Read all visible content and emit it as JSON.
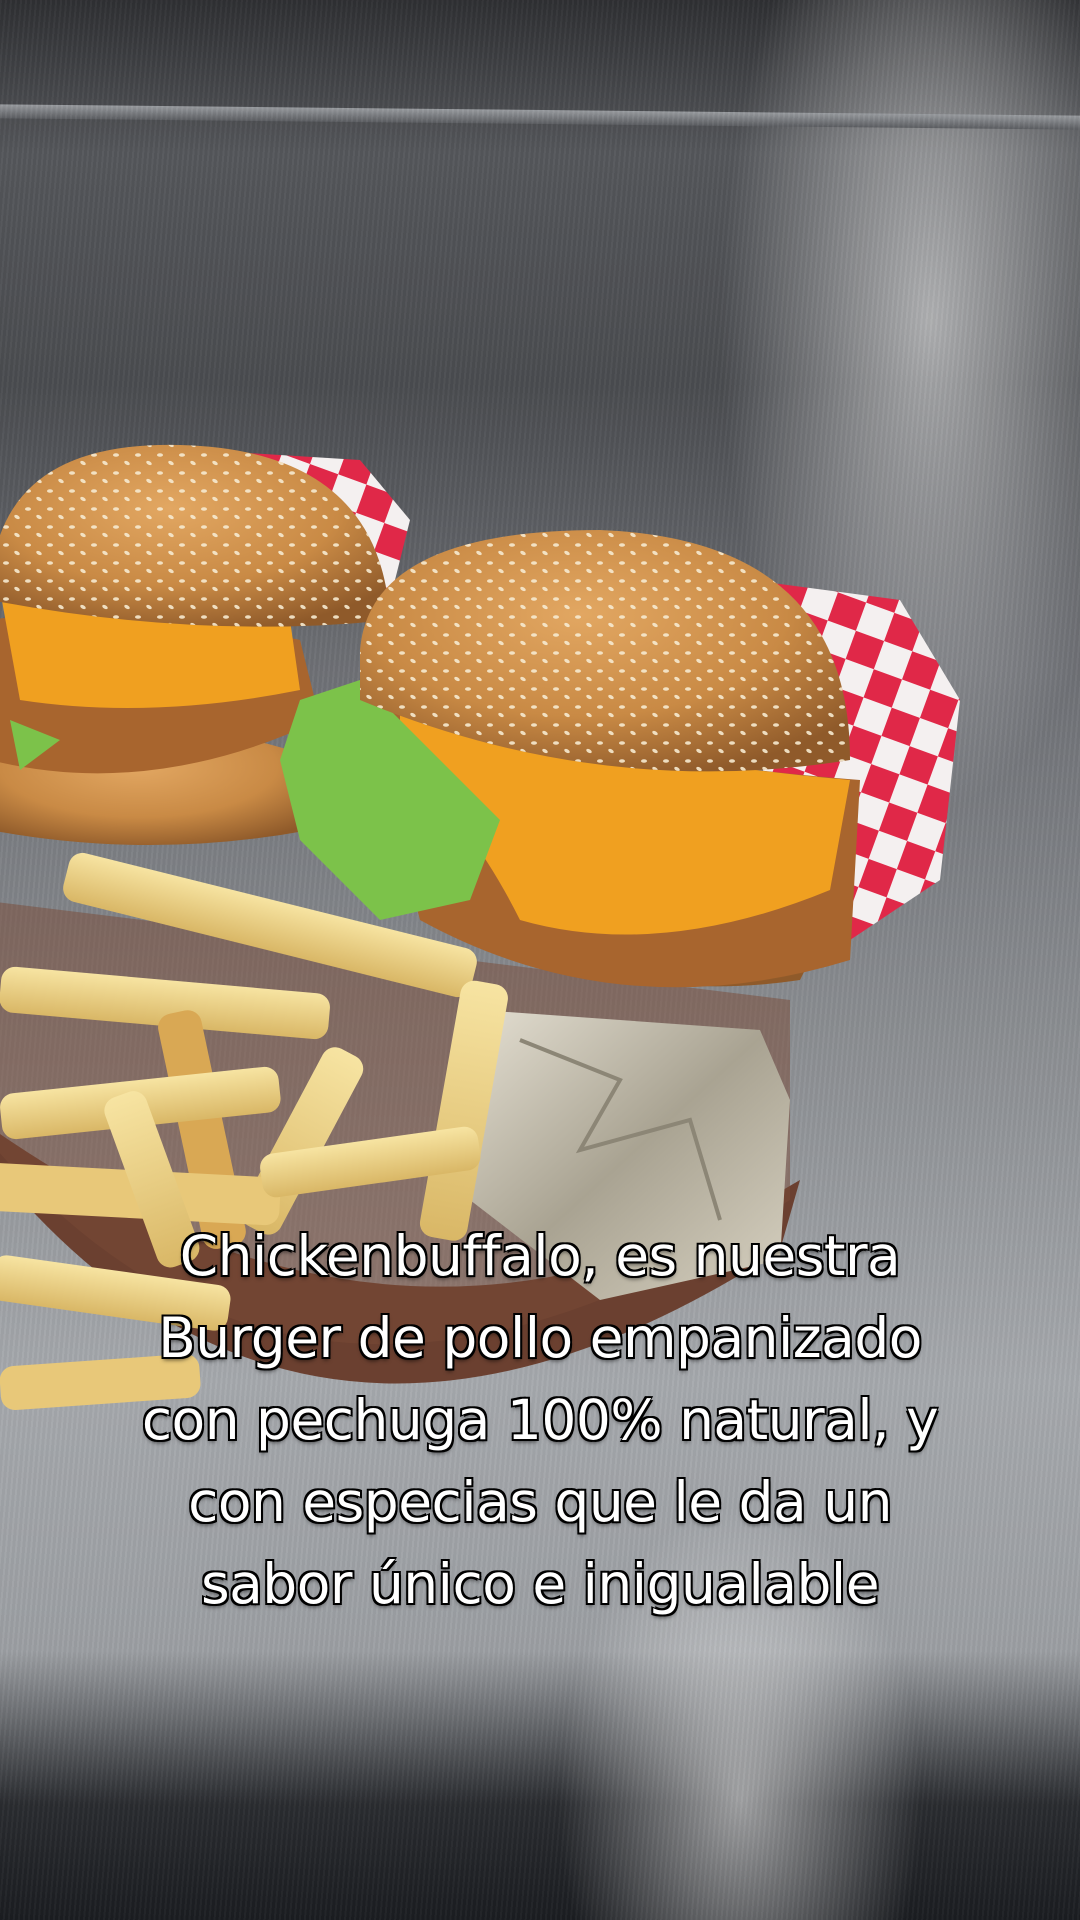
{
  "caption": {
    "lines": [
      "Chickenbuffalo, es nuestra",
      "Burger de pollo empanizado",
      "con pechuga 100% natural, y",
      "con especias que le da un",
      "sabor único e inigualable"
    ]
  },
  "colors": {
    "bun": "#c98a45",
    "cheese": "#f0a020",
    "lettuce": "#7cc24a",
    "fries": "#f2d98a",
    "paper_red": "#e02848",
    "foil": "#c8c2b0",
    "caption_text": "#ffffff",
    "caption_outline": "#000000"
  }
}
